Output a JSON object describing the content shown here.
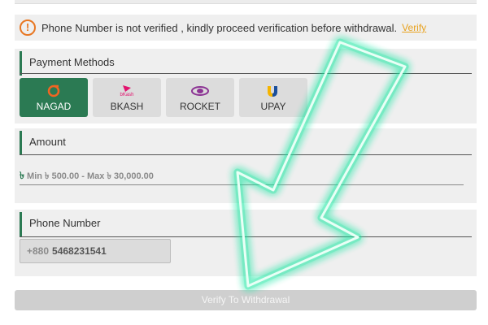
{
  "notice": {
    "icon": "exclamation-circle-icon",
    "text": "Phone Number is not verified , kindly proceed verification before withdrawal.",
    "link": "Verify",
    "color": "#e87722"
  },
  "payment_methods": {
    "title": "Payment Methods",
    "methods": [
      {
        "label": "NAGAD",
        "icon": "nagad-logo",
        "active": true
      },
      {
        "label": "BKASH",
        "icon": "bkash-logo",
        "logo_text": "bKash",
        "active": false
      },
      {
        "label": "ROCKET",
        "icon": "rocket-logo",
        "active": false
      },
      {
        "label": "UPAY",
        "icon": "upay-logo",
        "active": false
      }
    ],
    "accent": "#2b7a53"
  },
  "amount": {
    "title": "Amount",
    "currency_symbol": "৳",
    "range_text": "Min ৳ 500.00 - Max ৳ 30,000.00"
  },
  "phone": {
    "title": "Phone Number",
    "prefix": "+880",
    "value": "5468231541"
  },
  "submit": {
    "label": "Verify To Withdrawal"
  },
  "overlay": {
    "arrow": "down-left-arrow-icon",
    "color": "#19e6a0"
  }
}
